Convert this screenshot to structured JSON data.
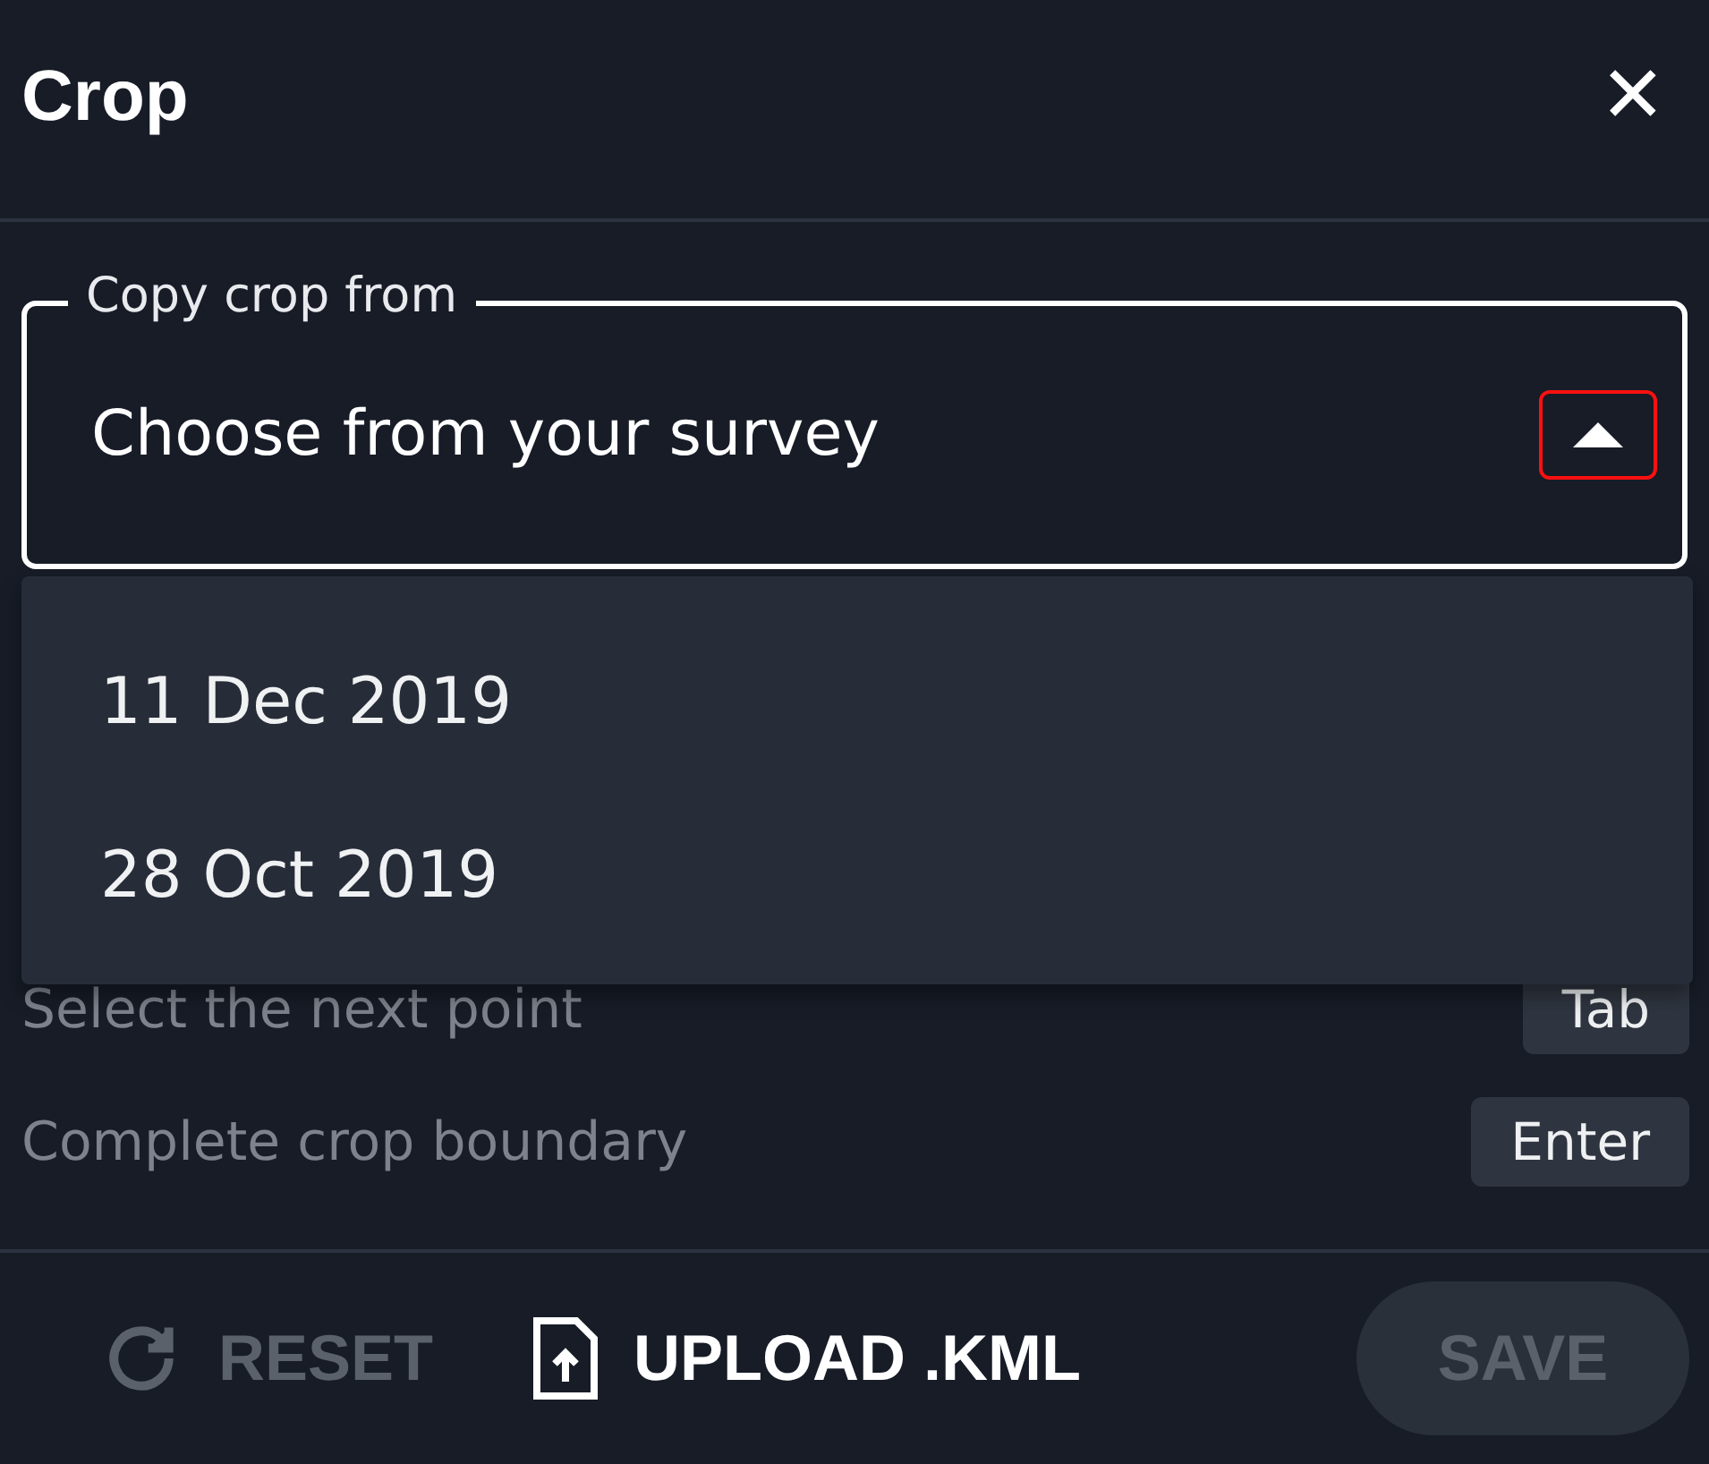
{
  "header": {
    "title": "Crop",
    "close_label": "✕"
  },
  "copy_field": {
    "label": "Copy crop from",
    "value": "Choose from your survey",
    "expanded": true,
    "caret_focused": true
  },
  "dropdown_options": [
    {
      "label": "11 Dec 2019"
    },
    {
      "label": "28 Oct 2019"
    }
  ],
  "shortcuts": [
    {
      "action": "Select the next point",
      "key": "Tab"
    },
    {
      "action": "Complete crop boundary",
      "key": "Enter"
    }
  ],
  "footer": {
    "reset": {
      "label": "RESET",
      "disabled": true
    },
    "upload": {
      "label": "UPLOAD .KML",
      "disabled": false
    },
    "save": {
      "label": "SAVE",
      "disabled": true
    }
  }
}
